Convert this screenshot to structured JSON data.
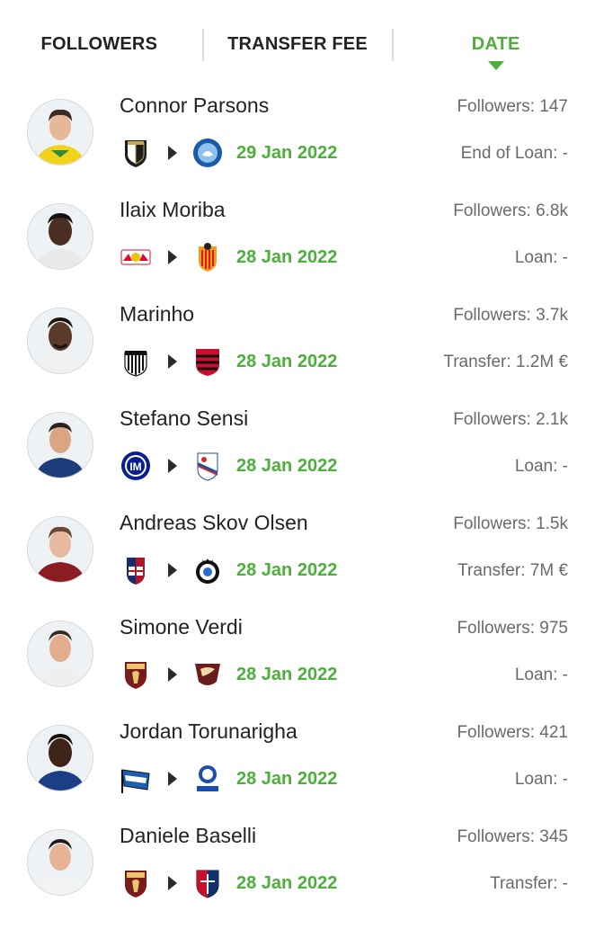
{
  "tabs": [
    {
      "label": "FOLLOWERS",
      "active": false
    },
    {
      "label": "TRANSFER FEE",
      "active": false
    },
    {
      "label": "DATE",
      "active": true
    }
  ],
  "colors": {
    "accent": "#4caf3a",
    "muted": "#6a6a6a",
    "text": "#222222"
  },
  "transfers": [
    {
      "player": "Connor Parsons",
      "followers": "Followers: 147",
      "date": "29 Jan 2022",
      "fee": "End of Loan: -",
      "from_club_icon": "notts-county-crest-icon",
      "to_club_icon": "wycombe-crest-icon"
    },
    {
      "player": "Ilaix Moriba",
      "followers": "Followers: 6.8k",
      "date": "28 Jan 2022",
      "fee": "Loan: -",
      "from_club_icon": "rb-leipzig-crest-icon",
      "to_club_icon": "valencia-crest-icon"
    },
    {
      "player": "Marinho",
      "followers": "Followers: 3.7k",
      "date": "28 Jan 2022",
      "fee": "Transfer: 1.2M €",
      "from_club_icon": "santos-crest-icon",
      "to_club_icon": "flamengo-crest-icon"
    },
    {
      "player": "Stefano Sensi",
      "followers": "Followers: 2.1k",
      "date": "28 Jan 2022",
      "fee": "Loan: -",
      "from_club_icon": "inter-crest-icon",
      "to_club_icon": "sampdoria-crest-icon"
    },
    {
      "player": "Andreas Skov Olsen",
      "followers": "Followers: 1.5k",
      "date": "28 Jan 2022",
      "fee": "Transfer: 7M €",
      "from_club_icon": "bologna-crest-icon",
      "to_club_icon": "club-brugge-crest-icon"
    },
    {
      "player": "Simone Verdi",
      "followers": "Followers: 975",
      "date": "28 Jan 2022",
      "fee": "Loan: -",
      "from_club_icon": "torino-crest-icon",
      "to_club_icon": "salernitana-crest-icon"
    },
    {
      "player": "Jordan Torunarigha",
      "followers": "Followers: 421",
      "date": "28 Jan 2022",
      "fee": "Loan: -",
      "from_club_icon": "hertha-crest-icon",
      "to_club_icon": "gent-crest-icon"
    },
    {
      "player": "Daniele Baselli",
      "followers": "Followers: 345",
      "date": "28 Jan 2022",
      "fee": "Transfer: -",
      "from_club_icon": "torino-crest-icon",
      "to_club_icon": "cagliari-crest-icon"
    }
  ]
}
